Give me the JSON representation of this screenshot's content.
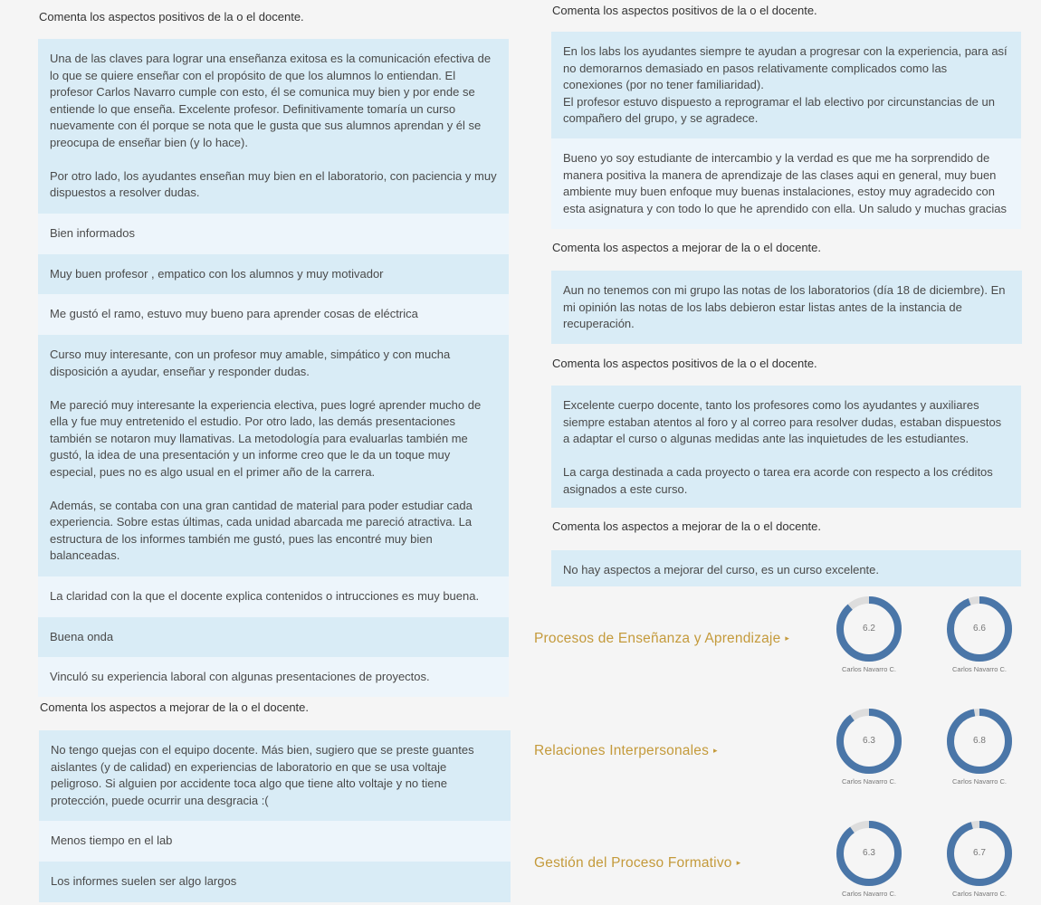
{
  "left": {
    "heading_positive": "Comenta los aspectos positivos de la o el docente.",
    "positive_comments": [
      {
        "paragraphs": [
          "Una de las claves para lograr una enseñanza exitosa es la comunicación efectiva de lo que se quiere enseñar con el propósito de que los alumnos lo entiendan. El profesor Carlos Navarro cumple con esto, él se comunica muy bien y por ende se entiende lo que enseña. Excelente profesor. Definitivamente tomaría un curso nuevamente con él porque se nota que le gusta que sus alumnos aprendan y él se preocupa de enseñar bien (y lo hace).",
          "Por otro lado, los ayudantes enseñan muy bien en el laboratorio, con paciencia y muy dispuestos a resolver dudas."
        ]
      },
      {
        "paragraphs": [
          "Bien informados"
        ]
      },
      {
        "paragraphs": [
          "Muy buen profesor , empatico con los alumnos y muy motivador"
        ]
      },
      {
        "paragraphs": [
          "Me gustó el ramo, estuvo muy bueno para aprender cosas de eléctrica"
        ]
      },
      {
        "paragraphs": [
          "Curso muy interesante, con un profesor muy amable, simpático y con mucha disposición a ayudar, enseñar y responder dudas.",
          "Me pareció muy interesante la experiencia electiva, pues logré aprender mucho de ella y fue muy entretenido el estudio. Por otro lado, las demás presentaciones también se notaron muy llamativas. La metodología para evaluarlas también me gustó, la idea de una presentación y un informe creo que le da un toque muy especial, pues no es algo usual en el primer año de la carrera.",
          "Además, se contaba con una gran cantidad de material para poder estudiar cada experiencia. Sobre estas últimas, cada unidad abarcada me pareció atractiva. La estructura de los informes también me gustó, pues las encontré muy bien balanceadas."
        ]
      },
      {
        "paragraphs": [
          "La claridad con la que el docente explica contenidos o intrucciones es muy buena."
        ]
      },
      {
        "paragraphs": [
          "Buena onda"
        ]
      },
      {
        "paragraphs": [
          "Vinculó su experiencia laboral con algunas presentaciones de proyectos."
        ]
      }
    ],
    "heading_improve": "Comenta los aspectos a mejorar de la o el docente.",
    "improve_comments": [
      {
        "paragraphs": [
          "No tengo quejas con el equipo docente. Más bien, sugiero que se preste guantes aislantes (y de calidad) en experiencias de laboratorio en que se usa voltaje peligroso. Si alguien por accidente toca algo que tiene alto voltaje y no tiene protección, puede ocurrir una desgracia :("
        ]
      },
      {
        "paragraphs": [
          "Menos tiempo en el lab"
        ]
      },
      {
        "paragraphs": [
          "Los informes suelen ser algo largos"
        ]
      }
    ]
  },
  "right": {
    "heading_positive_1": "Comenta los aspectos positivos de la o el docente.",
    "positive_comments_1": [
      {
        "paragraphs": [
          "En los labs los ayudantes siempre te ayudan a progresar con la experiencia, para así no demorarnos demasiado en pasos relativamente complicados como las conexiones (por no tener familiaridad).\nEl profesor estuvo dispuesto a reprogramar el lab electivo por circunstancias de un compañero del grupo, y se agradece."
        ]
      },
      {
        "paragraphs": [
          "Bueno yo soy estudiante de intercambio y la verdad es que me ha sorprendido de manera positiva la manera de aprendizaje de las clases aqui en general, muy buen ambiente muy buen enfoque muy buenas instalaciones, estoy muy agradecido con esta asignatura y con todo lo que he aprendido con ella. Un saludo y muchas gracias"
        ]
      }
    ],
    "heading_improve_1": "Comenta los aspectos a mejorar de la o el docente.",
    "improve_comments_1": [
      {
        "paragraphs": [
          "Aun no tenemos con mi grupo las notas de los laboratorios (día 18 de diciembre). En mi opinión las notas de los labs debieron estar listas antes de la instancia de recuperación."
        ]
      }
    ],
    "heading_positive_2": "Comenta los aspectos positivos de la o el docente.",
    "positive_comments_2": [
      {
        "paragraphs": [
          "Excelente cuerpo docente, tanto los profesores como los ayudantes y auxiliares siempre estaban atentos al foro y al correo para resolver dudas, estaban dispuestos a adaptar el curso o algunas medidas ante las inquietudes de les estudiantes.",
          "La carga destinada a cada proyecto o tarea era acorde con respecto a los créditos asignados a este curso."
        ]
      }
    ],
    "heading_improve_2": "Comenta los aspectos a mejorar de la o el docente.",
    "improve_comments_2": [
      {
        "paragraphs": [
          "No hay aspectos a mejorar del curso, es un curso excelente."
        ]
      }
    ]
  },
  "metrics": [
    {
      "label": "Procesos de Enseñanza y Aprendizaje",
      "arrow": "▸",
      "scores": [
        {
          "value": "6.2",
          "fraction": 0.886,
          "name": "Carlos Navarro C."
        },
        {
          "value": "6.6",
          "fraction": 0.943,
          "name": "Carlos Navarro C."
        }
      ]
    },
    {
      "label": "Relaciones Interpersonales",
      "arrow": "▸",
      "scores": [
        {
          "value": "6.3",
          "fraction": 0.9,
          "name": "Carlos Navarro C."
        },
        {
          "value": "6.8",
          "fraction": 0.971,
          "name": "Carlos Navarro C."
        }
      ]
    },
    {
      "label": "Gestión del Proceso Formativo",
      "arrow": "▸",
      "scores": [
        {
          "value": "6.3",
          "fraction": 0.9,
          "name": "Carlos Navarro C."
        },
        {
          "value": "6.7",
          "fraction": 0.957,
          "name": "Carlos Navarro C."
        }
      ]
    }
  ],
  "colors": {
    "donut_fill": "#4a76a8",
    "donut_track": "#dddddd",
    "metric_label": "#c49a3b"
  }
}
